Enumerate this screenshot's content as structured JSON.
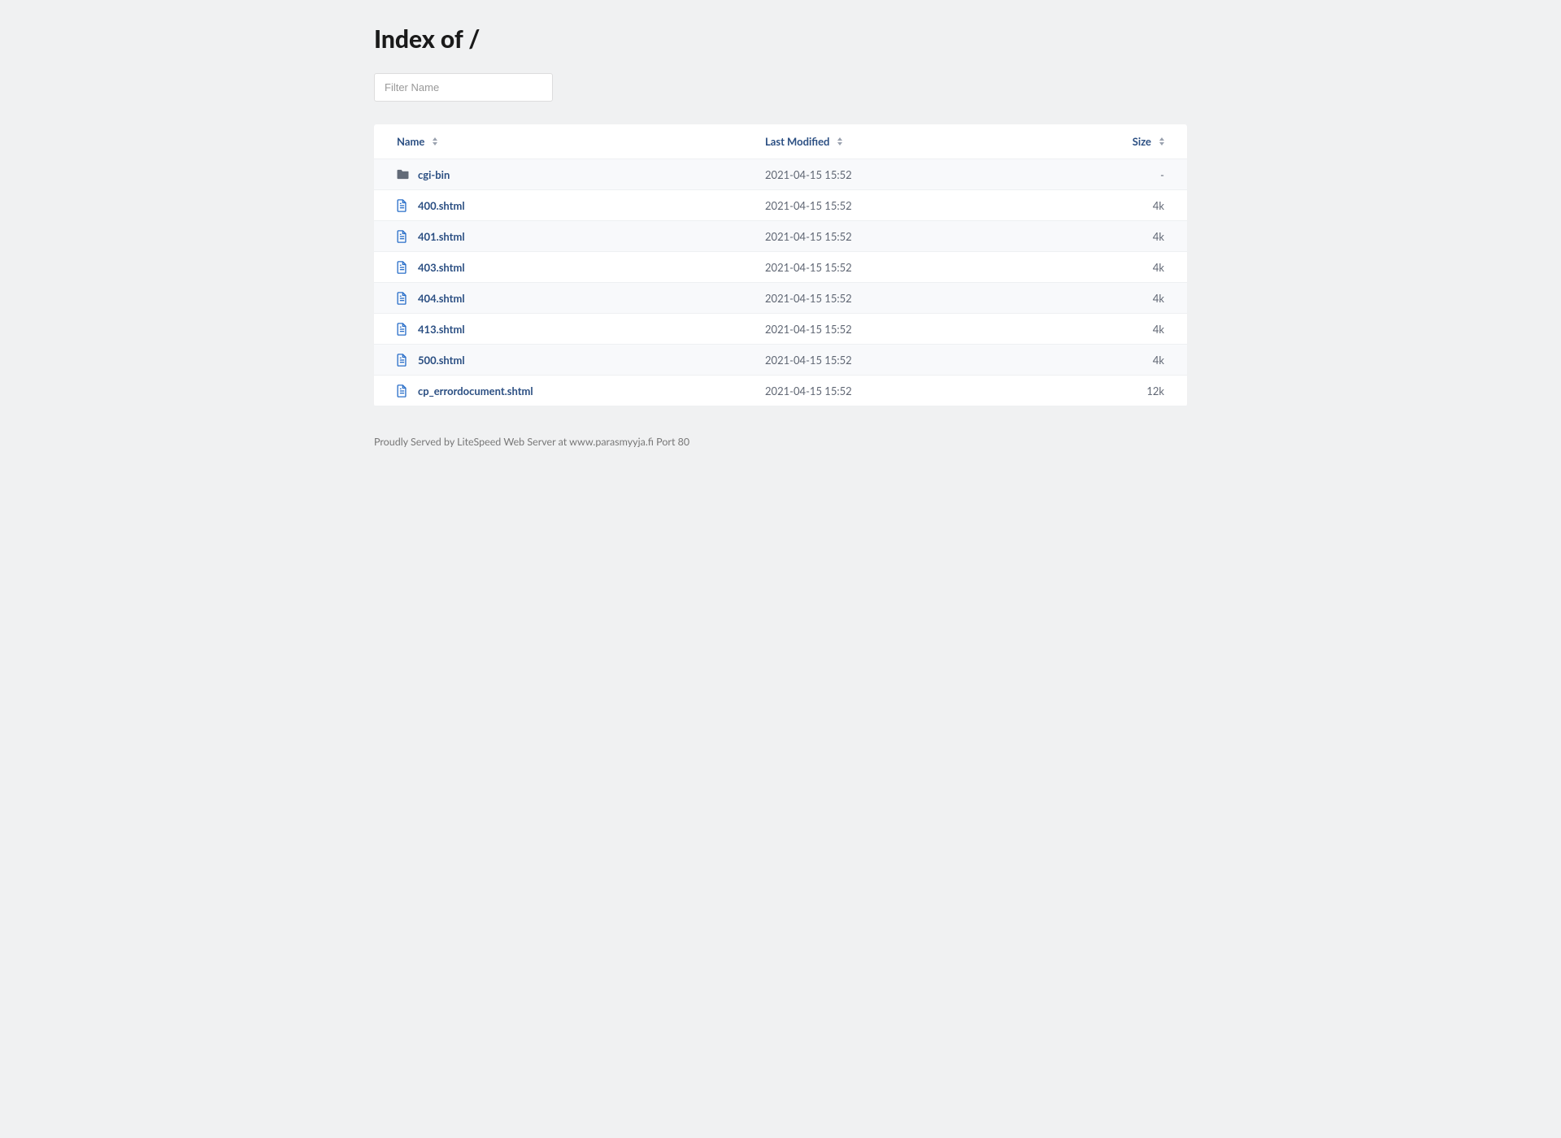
{
  "title": "Index of /",
  "filter": {
    "placeholder": "Filter Name",
    "value": ""
  },
  "columns": {
    "name": "Name",
    "modified": "Last Modified",
    "size": "Size"
  },
  "rows": [
    {
      "type": "folder",
      "name": "cgi-bin",
      "modified": "2021-04-15 15:52",
      "size": "-"
    },
    {
      "type": "file",
      "name": "400.shtml",
      "modified": "2021-04-15 15:52",
      "size": "4k"
    },
    {
      "type": "file",
      "name": "401.shtml",
      "modified": "2021-04-15 15:52",
      "size": "4k"
    },
    {
      "type": "file",
      "name": "403.shtml",
      "modified": "2021-04-15 15:52",
      "size": "4k"
    },
    {
      "type": "file",
      "name": "404.shtml",
      "modified": "2021-04-15 15:52",
      "size": "4k"
    },
    {
      "type": "file",
      "name": "413.shtml",
      "modified": "2021-04-15 15:52",
      "size": "4k"
    },
    {
      "type": "file",
      "name": "500.shtml",
      "modified": "2021-04-15 15:52",
      "size": "4k"
    },
    {
      "type": "file",
      "name": "cp_errordocument.shtml",
      "modified": "2021-04-15 15:52",
      "size": "12k"
    }
  ],
  "footer": "Proudly Served by LiteSpeed Web Server at www.parasmyyja.fi Port 80"
}
